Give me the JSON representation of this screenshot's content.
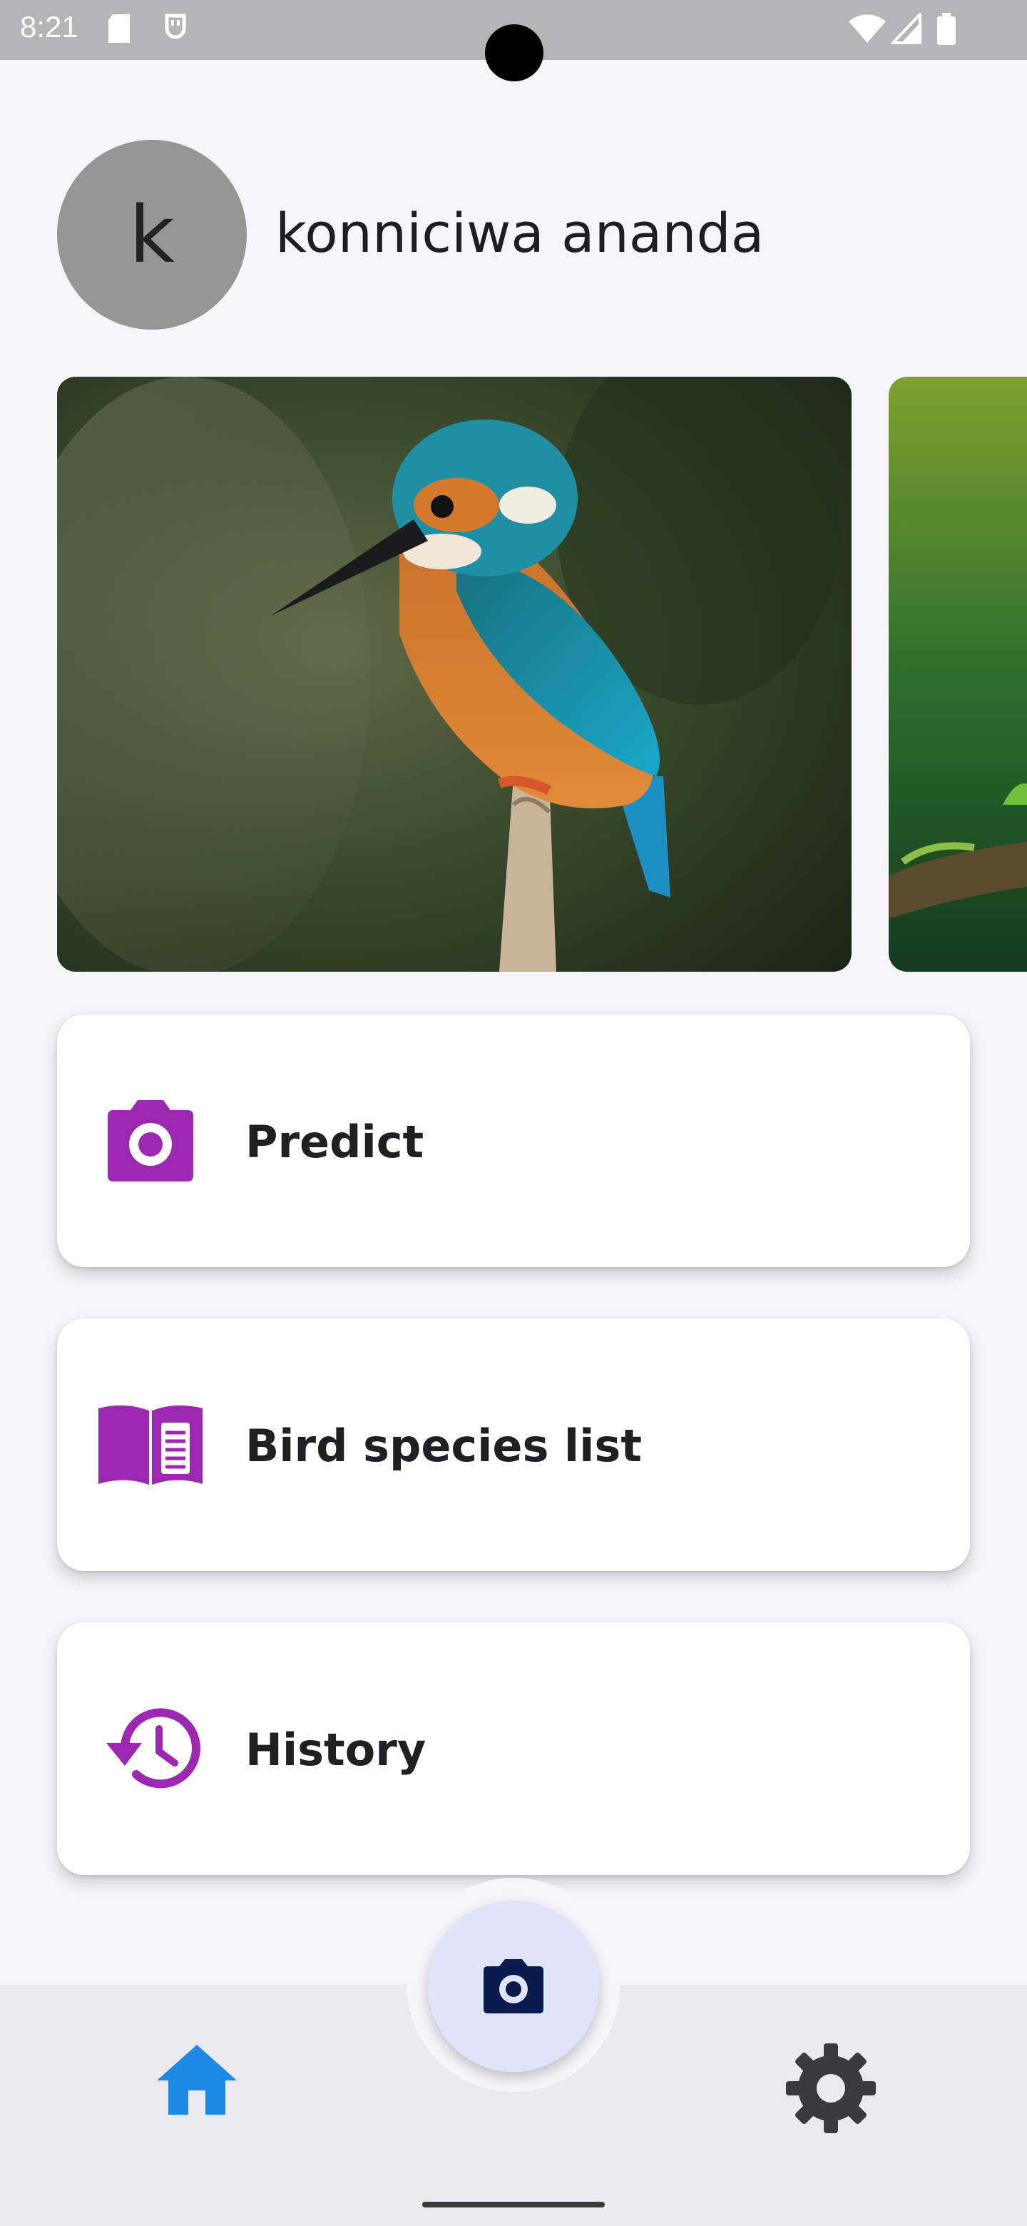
{
  "status_bar": {
    "time": "8:21",
    "icons": [
      "sd-card-icon",
      "usb-icon",
      "wifi-icon",
      "signal-icon",
      "battery-icon"
    ]
  },
  "header": {
    "avatar_initial": "k",
    "greeting": "konniciwa ananda"
  },
  "carousel": {
    "slides": [
      "kingfisher-photo",
      "forest-branch-photo"
    ]
  },
  "menu": [
    {
      "label": "Predict",
      "icon": "camera-icon"
    },
    {
      "label": "Bird species list",
      "icon": "book-icon"
    },
    {
      "label": "History",
      "icon": "history-icon"
    }
  ],
  "bottom_nav": {
    "home_icon": "home-icon",
    "fab_icon": "camera-icon",
    "settings_icon": "gear-icon"
  },
  "colors": {
    "accent_purple": "#9c27b0",
    "home_active": "#1e88e5",
    "fab_background": "#dfe4fb",
    "fab_icon": "#0d1b4c",
    "settings_icon": "#3a3a3f"
  }
}
